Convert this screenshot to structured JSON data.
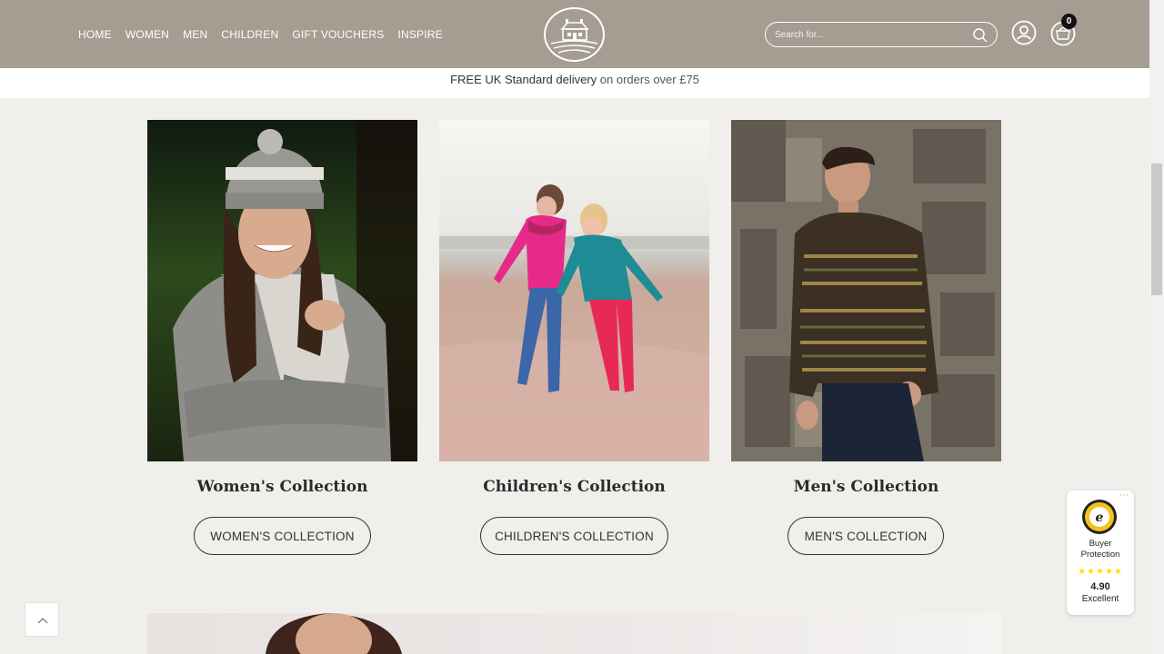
{
  "header": {
    "nav": [
      "HOME",
      "WOMEN",
      "MEN",
      "CHILDREN",
      "GIFT VOUCHERS",
      "INSPIRE"
    ],
    "search_placeholder": "Search for...",
    "basket_count": "0"
  },
  "delivery": {
    "bold": "FREE UK Standard delivery",
    "rest": " on orders over £75"
  },
  "collections": [
    {
      "title": "Women's Collection",
      "button": "WOMEN'S COLLECTION"
    },
    {
      "title": "Children's Collection",
      "button": "CHILDREN'S COLLECTION"
    },
    {
      "title": "Men's Collection",
      "button": "MEN'S COLLECTION"
    }
  ],
  "trust_badge": {
    "line1": "Buyer",
    "line2": "Protection",
    "stars": "★★★★★",
    "score": "4.90",
    "verdict": "Excellent"
  },
  "colors": {
    "header_bg": "#a59d92",
    "page_bg": "#f1efec"
  }
}
